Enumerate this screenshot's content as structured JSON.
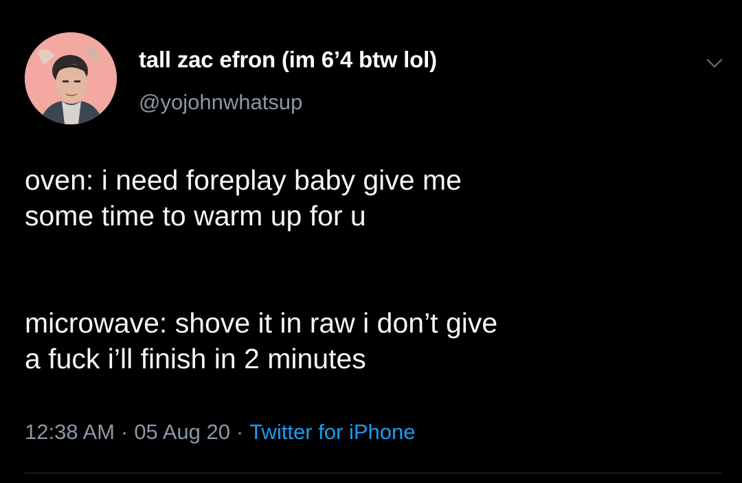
{
  "author": {
    "display_name": "tall zac efron (im 6’4 btw lol)",
    "handle": "@yojohnwhatsup",
    "avatar_icon": "profile-photo-avatar"
  },
  "tweet": {
    "line_group_1": [
      "oven: i need foreplay baby give me",
      "some time to warm up for u"
    ],
    "line_group_2": [
      "microwave: shove it in raw i don’t give",
      "a fuck i’ll finish in 2 minutes"
    ],
    "time": "12:38 AM",
    "date": "05 Aug 20",
    "source": "Twitter for iPhone",
    "separator": "·"
  },
  "icons": {
    "menu": "chevron-down-icon"
  },
  "colors": {
    "background": "#000000",
    "text": "#f5f7f8",
    "secondary": "#8b98a5",
    "accent": "#1d9bf0",
    "divider": "#2f3336"
  }
}
